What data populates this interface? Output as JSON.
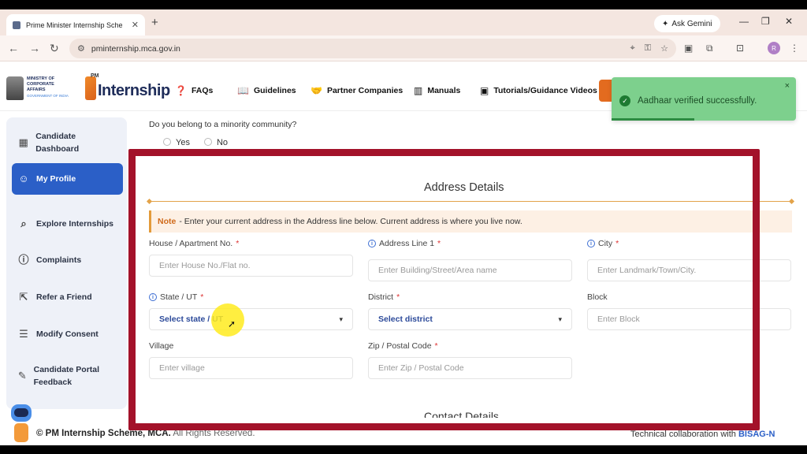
{
  "browser": {
    "tab_title": "Prime Minister Internship Sche",
    "tab_close": "✕",
    "new_tab": "+",
    "ask_gemini": "Ask Gemini",
    "url": "pminternship.mca.gov.in",
    "avatar_letter": "R"
  },
  "header": {
    "mca_logo_lines": [
      "MINISTRY OF",
      "CORPORATE",
      "AFFAIRS"
    ],
    "mca_gov": "GOVERNMENT OF INDIA",
    "pm_prefix": "PM",
    "logo_word": "Internship",
    "nav": [
      "FAQs",
      "Guidelines",
      "Partner Companies",
      "Manuals",
      "Tutorials/Guidance Videos"
    ]
  },
  "toast": {
    "message": "Aadhaar verified successfully.",
    "close": "×"
  },
  "sidebar": {
    "items": [
      {
        "label": "Candidate Dashboard",
        "icon": "grid-icon"
      },
      {
        "label": "My Profile",
        "icon": "user-icon",
        "active": true
      },
      {
        "label": "Explore Internships",
        "icon": "search-icon"
      },
      {
        "label": "Complaints",
        "icon": "info-icon"
      },
      {
        "label": "Refer a Friend",
        "icon": "refer-icon"
      },
      {
        "label": "Modify Consent",
        "icon": "list-icon"
      },
      {
        "label": "Candidate Portal Feedback",
        "icon": "feedback-icon"
      }
    ]
  },
  "form": {
    "minority_question": "Do you belong to a minority community?",
    "yes_label": "Yes",
    "no_label": "No",
    "section_title": "Address Details",
    "note_label": "Note",
    "note_text": "- Enter your current address in the Address line below. Current address is where you live now.",
    "house_label": "House / Apartment No.",
    "house_placeholder": "Enter House No./Flat no.",
    "address_line_label": "Address Line 1",
    "address_line_placeholder": "Enter Building/Street/Area name",
    "city_label": "City",
    "city_placeholder": "Enter Landmark/Town/City.",
    "state_label": "State / UT",
    "state_value": "Select state / UT",
    "district_label": "District",
    "district_value": "Select district",
    "block_label": "Block",
    "block_placeholder": "Enter Block",
    "village_label": "Village",
    "village_placeholder": "Enter village",
    "zip_label": "Zip / Postal Code",
    "zip_placeholder": "Enter Zip / Postal Code",
    "required_mark": "*",
    "next_section": "Contact Details"
  },
  "footer": {
    "copyright_prefix": "© PM Internship Scheme, MCA.",
    "copyright_suffix": "All Rights Reserved.",
    "collab_text": "Technical collaboration with",
    "collab_org": "BISAG-N"
  },
  "colors": {
    "accent_blue": "#2b5fc7",
    "highlight_red": "#a3122a",
    "toast_green": "#7dd08d",
    "brand_orange": "#e36b1f"
  }
}
